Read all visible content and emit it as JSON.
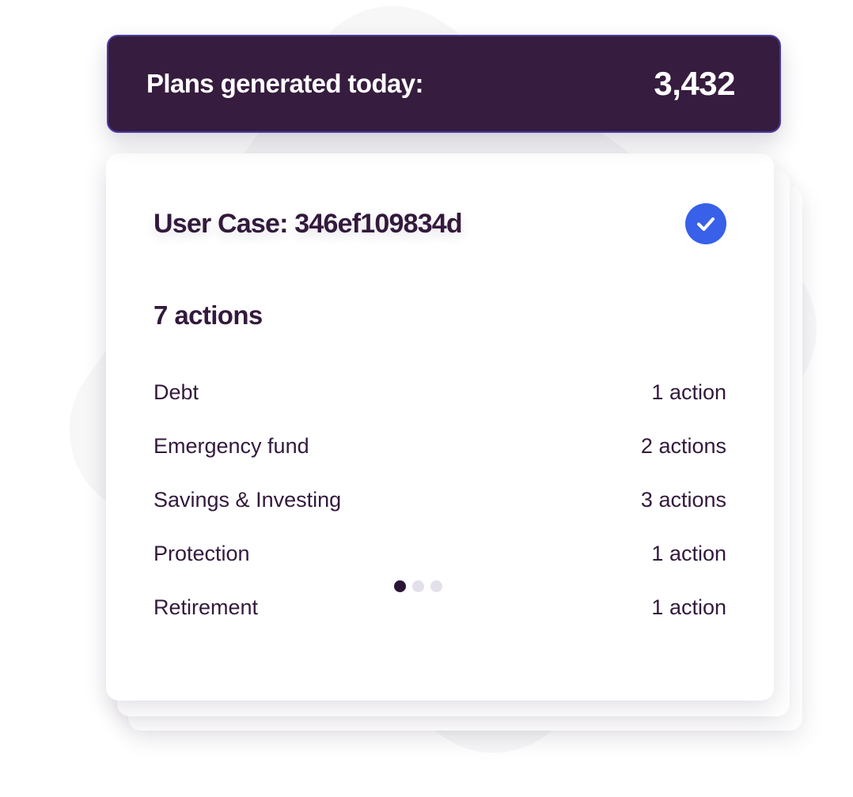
{
  "header": {
    "title": "Plans generated today:",
    "value": "3,432"
  },
  "card": {
    "case_title": "User Case: 346ef109834d",
    "status_icon": "check-circle-icon",
    "actions_heading": "7 actions",
    "items": [
      {
        "label": "Debt",
        "count": "1 action"
      },
      {
        "label": "Emergency fund",
        "count": "2 actions"
      },
      {
        "label": "Savings & Investing",
        "count": "3 actions"
      },
      {
        "label": "Protection",
        "count": "1 action"
      },
      {
        "label": "Retirement",
        "count": "1 action"
      }
    ],
    "pager": {
      "total": 3,
      "active": 1
    }
  },
  "colors": {
    "banner_bg": "#361c3e",
    "text_dark": "#331a3c",
    "accent_blue": "#3860e8",
    "dot_inactive": "#e4e0ea"
  }
}
